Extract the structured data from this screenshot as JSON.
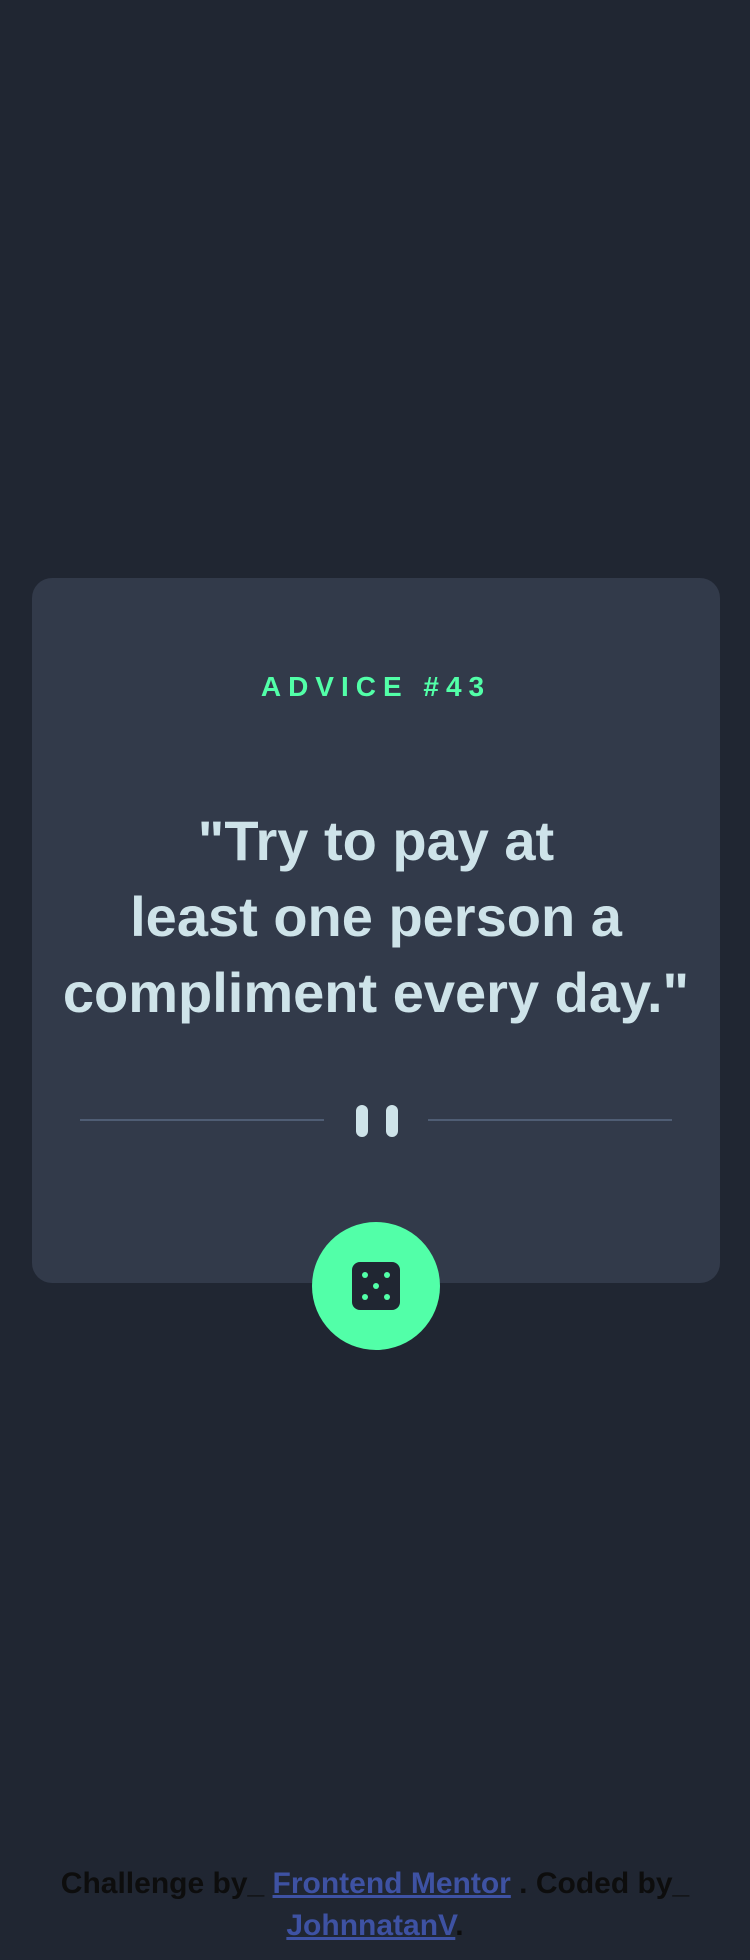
{
  "card": {
    "advice_label": "ADVICE #43",
    "quote_lines": [
      "\"Try to pay at",
      "least one person a",
      "compliment every day.\""
    ]
  },
  "divider": {
    "icon": "pause-icon"
  },
  "dice_button": {
    "icon": "dice-icon"
  },
  "footer": {
    "prefix": "Challenge by_ ",
    "link1": "Frontend Mentor",
    "middle": " . Coded by_ ",
    "link2": "JohnnatanV",
    "suffix": "."
  },
  "colors": {
    "background": "#202632",
    "card": "#323a4a",
    "accent": "#52ffa8",
    "text": "#cee3e9",
    "divider": "#4f5d74",
    "link": "#3e52a3"
  }
}
